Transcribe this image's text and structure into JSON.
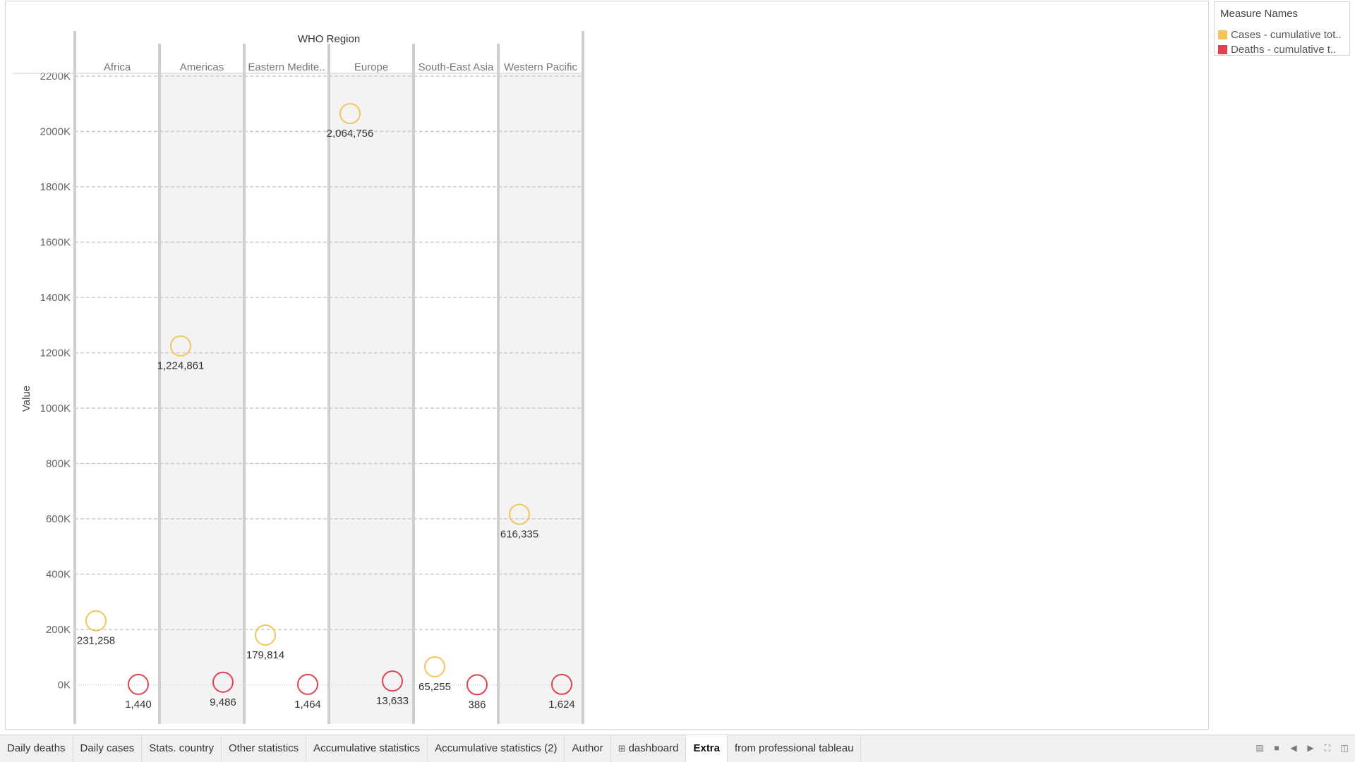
{
  "chart_data": {
    "type": "scatter",
    "column_header": "WHO Region",
    "categories": [
      "Africa",
      "Americas",
      "Eastern Medite..",
      "Europe",
      "South-East Asia",
      "Western Pacific"
    ],
    "ylabel": "Value",
    "ylim": [
      -140000,
      2300000
    ],
    "y_ticks": [
      0,
      200000,
      400000,
      600000,
      800000,
      1000000,
      1200000,
      1400000,
      1600000,
      1800000,
      2000000,
      2200000
    ],
    "y_tick_labels": [
      "0K",
      "200K",
      "400K",
      "600K",
      "800K",
      "1000K",
      "1200K",
      "1400K",
      "1600K",
      "1800K",
      "2000K",
      "2200K"
    ],
    "grid": true,
    "legend_position": "top-right",
    "series": [
      {
        "name": "Cases - cumulative tot..",
        "color": "#f2c65a",
        "values": [
          231258,
          1224861,
          179814,
          2064756,
          65255,
          616335
        ],
        "labels": [
          "231,258",
          "1,224,861",
          "179,814",
          "2,064,756",
          "65,255",
          "616,335"
        ]
      },
      {
        "name": "Deaths - cumulative t..",
        "color": "#e0434f",
        "values": [
          1440,
          9486,
          1464,
          13633,
          386,
          1624
        ],
        "labels": [
          "1,440",
          "9,486",
          "1,464",
          "13,633",
          "386",
          "1,624"
        ]
      }
    ]
  },
  "legend": {
    "title": "Measure Names",
    "items": [
      {
        "label": "Cases - cumulative tot..",
        "color": "#f2c65a"
      },
      {
        "label": "Deaths - cumulative t..",
        "color": "#e0434f"
      }
    ]
  },
  "tabs": [
    {
      "label": "Daily deaths"
    },
    {
      "label": "Daily cases"
    },
    {
      "label": "Stats. country"
    },
    {
      "label": "Other statistics"
    },
    {
      "label": "Accumulative statistics"
    },
    {
      "label": "Accumulative statistics (2)"
    },
    {
      "label": "Author"
    },
    {
      "label": "dashboard",
      "icon": "dashboard-icon"
    },
    {
      "label": "Extra",
      "active": true
    },
    {
      "label": "from professional tableau"
    }
  ],
  "controls": [
    "show-filmstrip-icon",
    "show-sheet-icon",
    "previous-sheet-icon",
    "next-sheet-icon",
    "fullscreen-icon",
    "presentation-mode-icon"
  ]
}
